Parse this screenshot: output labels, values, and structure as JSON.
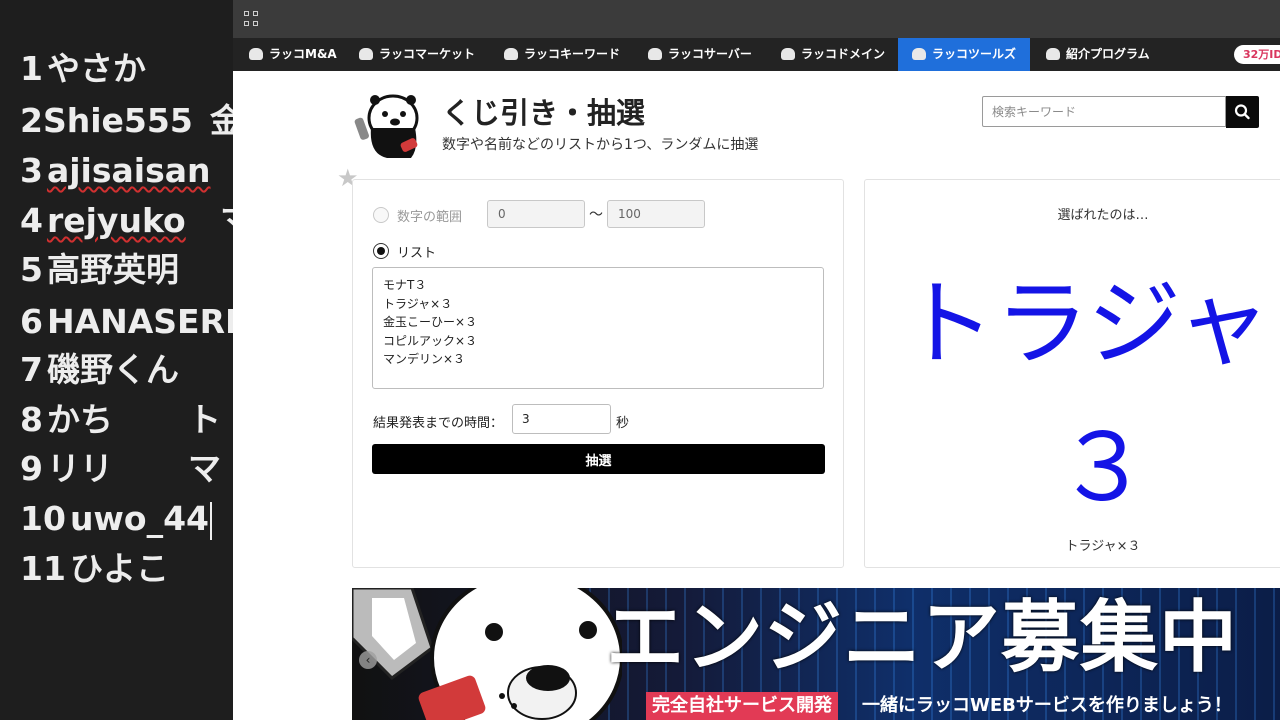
{
  "left_panel": {
    "rows": [
      {
        "num": "1",
        "name": "やさか",
        "extra": ""
      },
      {
        "num": "2",
        "name": "Shie555",
        "extra": "金"
      },
      {
        "num": "3",
        "name": "ajisaisan",
        "extra": ""
      },
      {
        "num": "4",
        "name": "rejyuko",
        "extra": "マ"
      },
      {
        "num": "5",
        "name": "高野英明",
        "extra": ""
      },
      {
        "num": "6",
        "name": "HANASEREE",
        "extra": ""
      },
      {
        "num": "7",
        "name": "磯野くん",
        "extra": ""
      },
      {
        "num": "8",
        "name": "かち",
        "extra": "ト"
      },
      {
        "num": "9",
        "name": "リリ",
        "extra": "マ"
      },
      {
        "num": "10",
        "name": "uwo_44",
        "extra": ""
      },
      {
        "num": "11",
        "name": "ひよこ",
        "extra": ""
      }
    ]
  },
  "nav": {
    "items": [
      {
        "label": "ラッコM&A"
      },
      {
        "label": "ラッコマーケット"
      },
      {
        "label": "ラッコキーワード"
      },
      {
        "label": "ラッコサーバー"
      },
      {
        "label": "ラッコドメイン"
      },
      {
        "label": "ラッコツールズ"
      },
      {
        "label": "紹介プログラム"
      }
    ],
    "active_label": "ラッコツールズ",
    "badge": "32万ID"
  },
  "header": {
    "title": "くじ引き・抽選",
    "subtitle": "数字や名前などのリストから1つ、ランダムに抽選",
    "search_placeholder": "検索キーワード"
  },
  "form": {
    "range_label": "数字の範囲",
    "range_min": "0",
    "range_tilde": "〜",
    "range_max": "100",
    "list_label": "リスト",
    "list_items": [
      "モナT３",
      "トラジャ×３",
      "金玉こーひー×３",
      "コピルアック×３",
      "マンデリン×３"
    ],
    "time_label": "結果発表までの時間：",
    "time_value": "3",
    "time_unit": "秒",
    "draw_button": "抽選"
  },
  "result": {
    "heading": "選ばれたのは…",
    "big_line1": "トラジャ×",
    "big_line2": "３",
    "small": "トラジャ×３",
    "color": "#1414e6"
  },
  "banner": {
    "title": "エンジニア募集中",
    "tag": "完全自社サービス開発",
    "subtitle": "一緒にラッコWEBサービスを作りましょう！"
  },
  "colors": {
    "nav_active": "#1f6fdb",
    "badge_text": "#d9365e"
  }
}
